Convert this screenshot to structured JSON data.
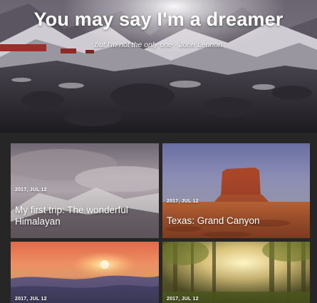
{
  "hero": {
    "title": "You may say I'm a dreamer",
    "subtitle": "but I'm not the only one - John Lennon"
  },
  "posts": [
    {
      "date": "2017, JUL 12",
      "title": "My first trip: The wonderful Himalayan",
      "image": "snowy-mountain-clouds"
    },
    {
      "date": "2017, JUL 12",
      "title": "Texas: Grand Canyon",
      "image": "desert-butte"
    },
    {
      "date": "2017, JUL 12",
      "title": "",
      "image": "ocean-sunset"
    },
    {
      "date": "2017, JUL 12",
      "title": "",
      "image": "sunlit-forest"
    }
  ]
}
